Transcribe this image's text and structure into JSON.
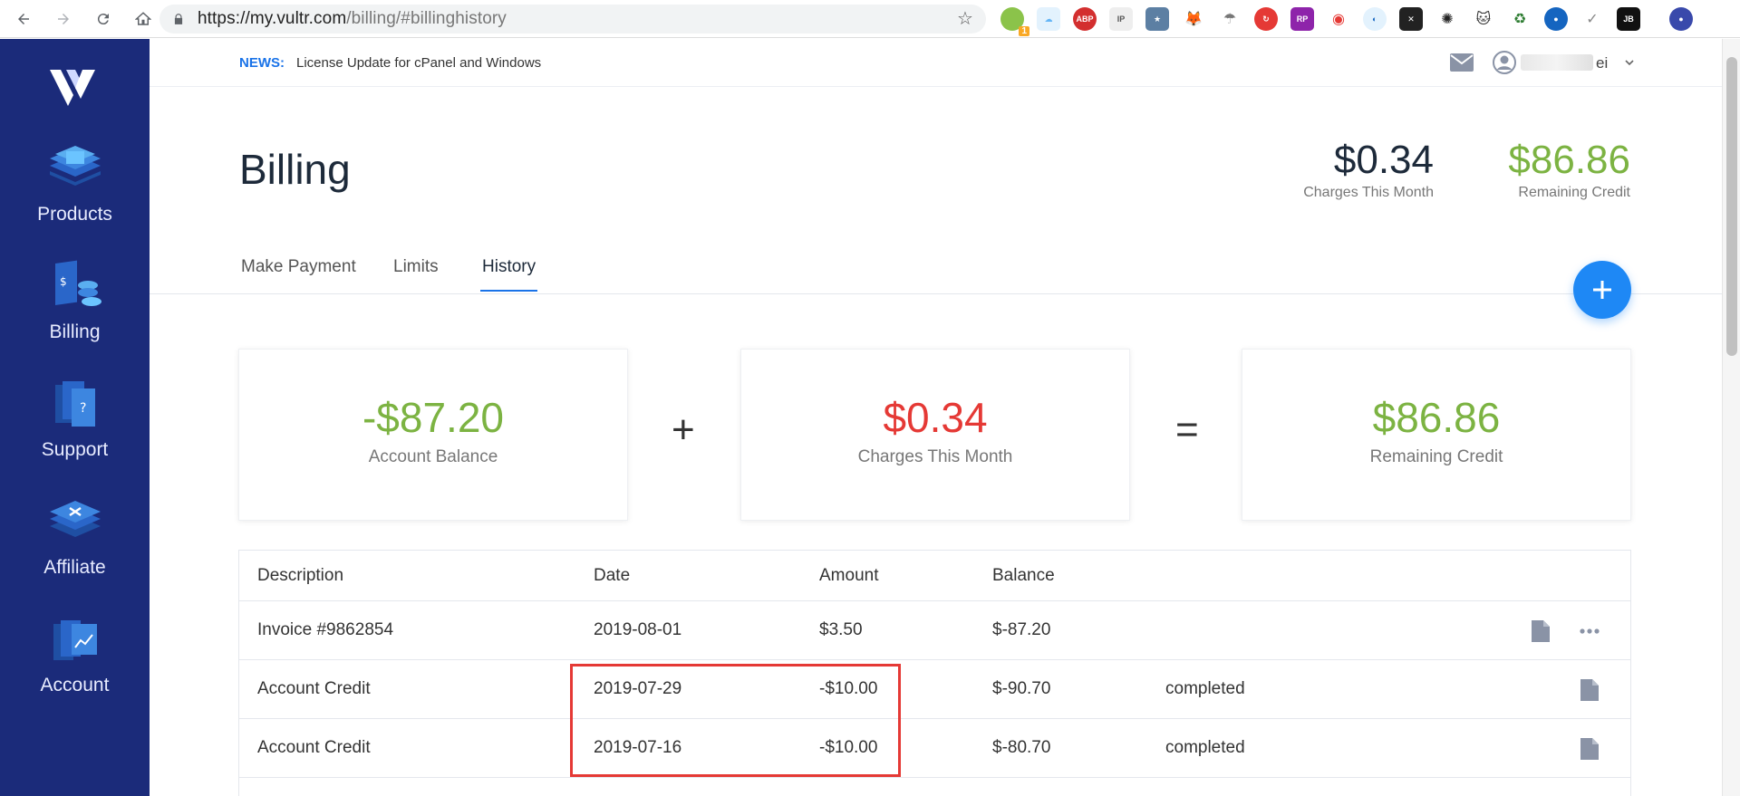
{
  "browser": {
    "url_host": "https://my.vultr.com",
    "url_path": "/billing/#billinghistory",
    "ext_badge": "1",
    "extensions": [
      "status-ext",
      "cloud-ext",
      "abp-ext",
      "ip-ext",
      "bookmark-ext",
      "fox-ext",
      "parachute-ext",
      "red-ext",
      "rp-ext",
      "weibo-ext",
      "web-ext",
      "dark-ext",
      "aperture-ext",
      "cat-ext",
      "refresh-ext",
      "globe-ext",
      "check-ext",
      "jb-ext",
      "profile-ext"
    ],
    "ext_labels": {
      "abp": "ABP",
      "ip": "IP",
      "rp": "RP",
      "jb": "JB"
    }
  },
  "sidebar": {
    "items": [
      {
        "label": "Products"
      },
      {
        "label": "Billing"
      },
      {
        "label": "Support"
      },
      {
        "label": "Affiliate"
      },
      {
        "label": "Account"
      }
    ]
  },
  "topbar": {
    "news_label": "NEWS:",
    "news_text": "License Update for cPanel and Windows",
    "user_name_tail": "ei"
  },
  "header": {
    "title": "Billing",
    "charges_value": "$0.34",
    "charges_caption": "Charges This Month",
    "credit_value": "$86.86",
    "credit_caption": "Remaining Credit"
  },
  "tabs": [
    {
      "label": "Make Payment"
    },
    {
      "label": "Limits"
    },
    {
      "label": "History"
    }
  ],
  "cards": {
    "balance": {
      "value": "-$87.20",
      "caption": "Account Balance"
    },
    "plus": "+",
    "charges": {
      "value": "$0.34",
      "caption": "Charges This Month"
    },
    "equals": "=",
    "credit": {
      "value": "$86.86",
      "caption": "Remaining Credit"
    }
  },
  "table": {
    "headers": {
      "description": "Description",
      "date": "Date",
      "amount": "Amount",
      "balance": "Balance"
    },
    "rows": [
      {
        "description": "Invoice #9862854",
        "date": "2019-08-01",
        "amount": "$3.50",
        "balance": "$-87.20",
        "status": ""
      },
      {
        "description": "Account Credit",
        "date": "2019-07-29",
        "amount": "-$10.00",
        "balance": "$-90.70",
        "status": "completed"
      },
      {
        "description": "Account Credit",
        "date": "2019-07-16",
        "amount": "-$10.00",
        "balance": "$-80.70",
        "status": "completed"
      }
    ]
  },
  "colors": {
    "sidebar": "#1b2b7a",
    "accent": "#1a73e8",
    "positive": "#7cb342",
    "negative": "#e53935",
    "fab": "#1e88f5"
  }
}
